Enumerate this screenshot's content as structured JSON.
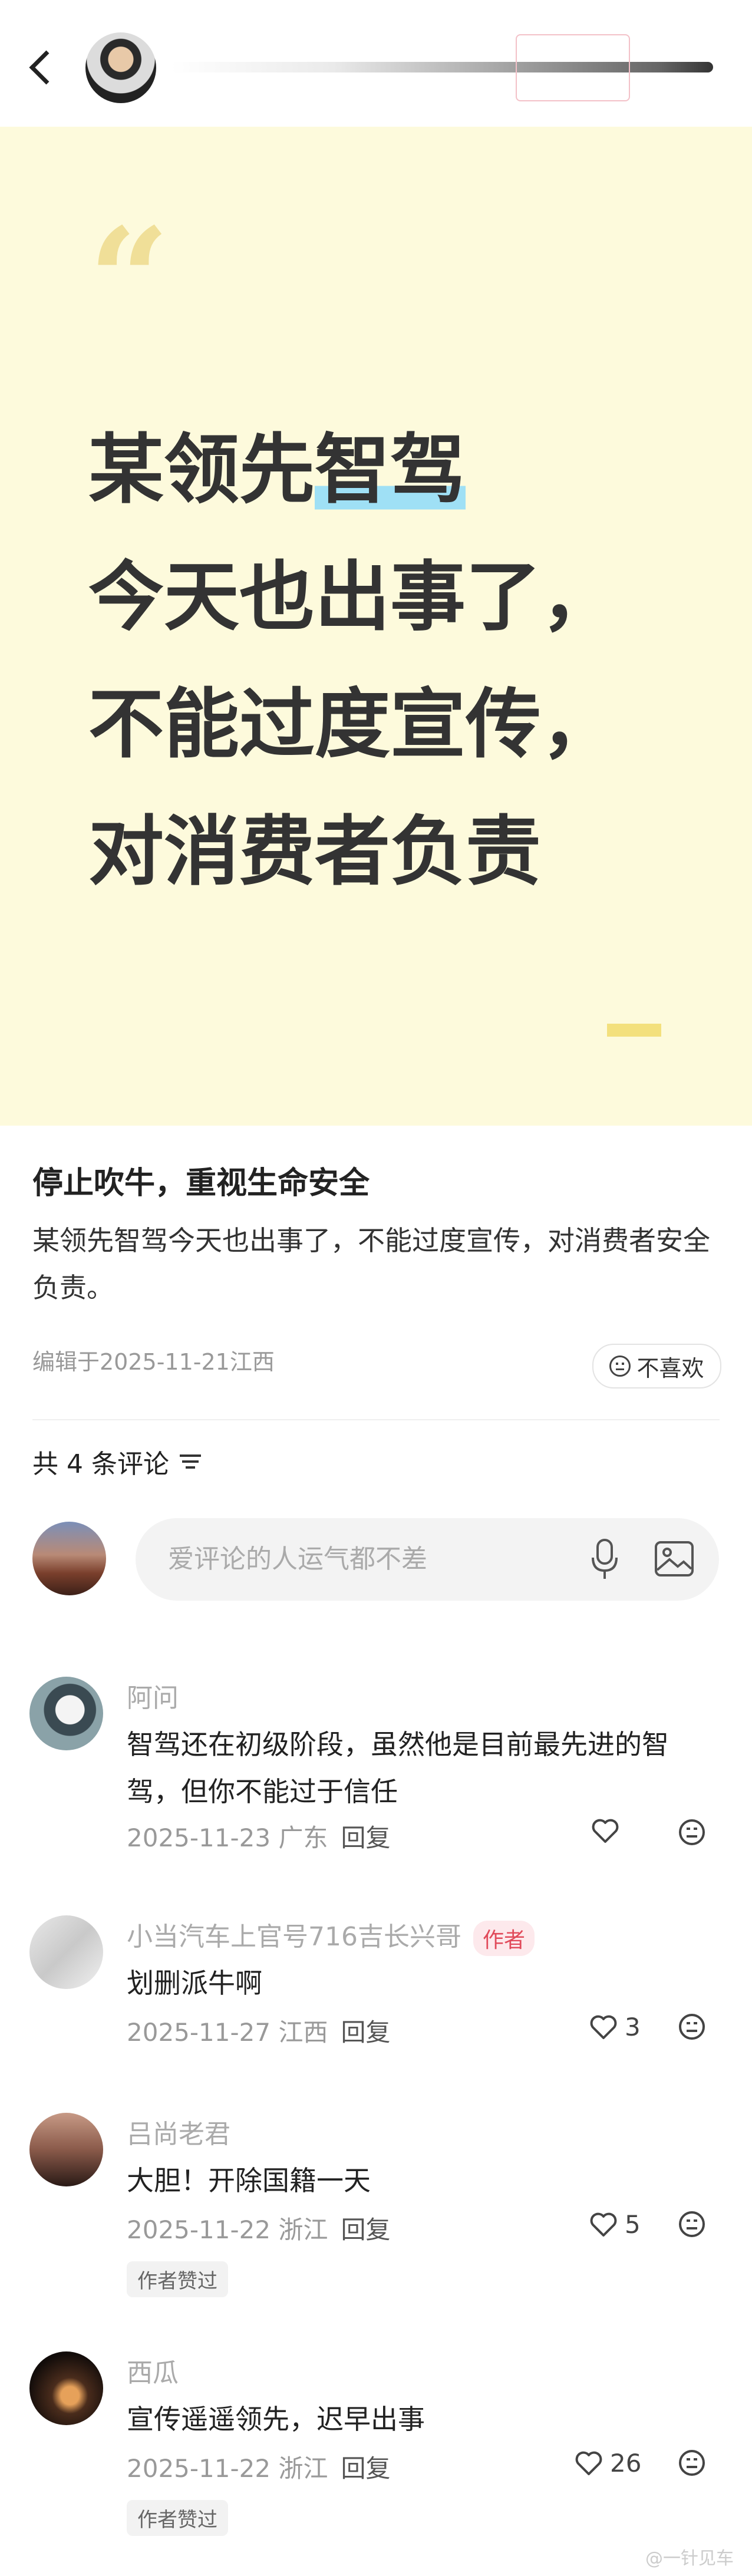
{
  "header": {
    "author_name": "",
    "follow_label": ""
  },
  "hero": {
    "lines": [
      "某领先",
      "智驾",
      "今天也出事了，",
      "不能过度宣传，",
      "对消费者负责"
    ]
  },
  "post": {
    "title": "停止吹牛，重视生命安全",
    "body": "某领先智驾今天也出事了，不能过度宣传，对消费者安全负责。",
    "meta": "编辑于2025-11-21江西",
    "dislike_label": "不喜欢"
  },
  "comments_section": {
    "count_label": "共 4 条评论",
    "input_placeholder": "爱评论的人运气都不差"
  },
  "comments": [
    {
      "name": "阿问",
      "badge": "",
      "text": "智驾还在初级阶段，虽然他是目前最先进的智驾，但你不能过于信任",
      "date": "2025-11-23",
      "location": "广东",
      "reply": "回复",
      "likes": "",
      "liked_tag": ""
    },
    {
      "name": "小当汽车上官号716吉长兴哥",
      "badge": "作者",
      "text": "划删派牛啊",
      "date": "2025-11-27",
      "location": "江西",
      "reply": "回复",
      "likes": "3",
      "liked_tag": ""
    },
    {
      "name": "吕尚老君",
      "badge": "",
      "text": "大胆！开除国籍一天",
      "date": "2025-11-22",
      "location": "浙江",
      "reply": "回复",
      "likes": "5",
      "liked_tag": "作者赞过"
    },
    {
      "name": "西瓜",
      "badge": "",
      "text": "宣传遥遥领先，迟早出事",
      "date": "2025-11-22",
      "location": "浙江",
      "reply": "回复",
      "likes": "26",
      "liked_tag": "作者赞过"
    }
  ],
  "watermark": "@一针见车"
}
